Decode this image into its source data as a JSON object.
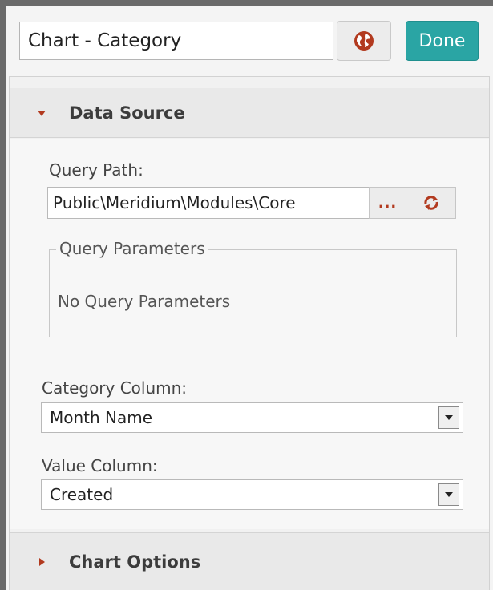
{
  "header": {
    "title_value": "Chart - Category",
    "done_label": "Done"
  },
  "data_source": {
    "section_label": "Data Source",
    "query_path_label": "Query Path:",
    "query_path_value": "Public\\Meridium\\Modules\\Core",
    "browse_label": "...",
    "query_parameters_legend": "Query Parameters",
    "no_parameters_text": "No Query Parameters",
    "category_column_label": "Category Column:",
    "category_column_value": "Month Name",
    "value_column_label": "Value Column:",
    "value_column_value": "Created"
  },
  "chart_options": {
    "section_label": "Chart Options"
  },
  "colors": {
    "accent": "#2aa5a4",
    "icon_red": "#b23a1f"
  },
  "icons": [
    "globe-icon",
    "ellipsis-icon",
    "refresh-icon",
    "collapse-arrow-icon",
    "expand-arrow-icon",
    "dropdown-arrow-icon"
  ]
}
